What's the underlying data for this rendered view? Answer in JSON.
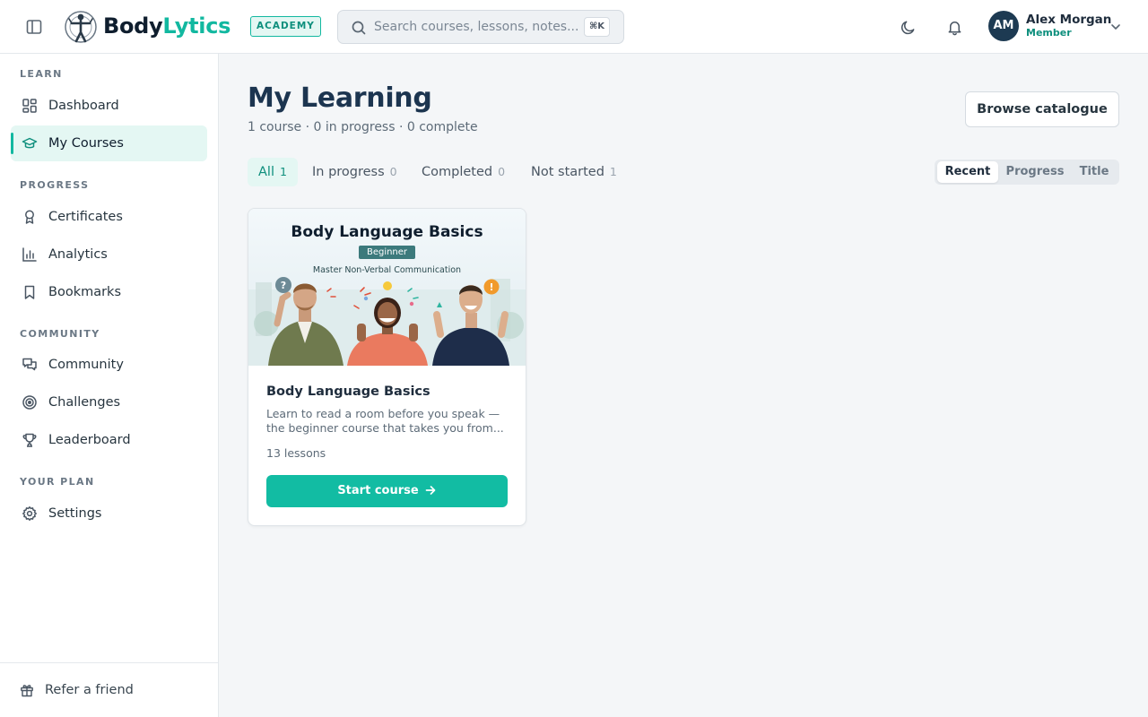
{
  "header": {
    "brand_part1": "Body",
    "brand_part2": "Lytics",
    "academy_badge": "ACADEMY",
    "search_placeholder": "Search courses, lessons, notes...",
    "search_shortcut": "⌘K",
    "user": {
      "initials": "AM",
      "name": "Alex Morgan",
      "role": "Member"
    }
  },
  "sidebar": {
    "sections": {
      "learn": "LEARN",
      "progress": "PROGRESS",
      "community": "COMMUNITY",
      "plan": "YOUR PLAN"
    },
    "items": {
      "dashboard": "Dashboard",
      "my_courses": "My Courses",
      "certificates": "Certificates",
      "analytics": "Analytics",
      "bookmarks": "Bookmarks",
      "community": "Community",
      "challenges": "Challenges",
      "leaderboard": "Leaderboard",
      "settings": "Settings"
    },
    "footer": "Refer a friend"
  },
  "main": {
    "title": "My Learning",
    "subtitle": "1 course · 0 in progress · 0 complete",
    "browse_button": "Browse catalogue",
    "filters": [
      {
        "label": "All",
        "count": "1"
      },
      {
        "label": "In progress",
        "count": "0"
      },
      {
        "label": "Completed",
        "count": "0"
      },
      {
        "label": "Not started",
        "count": "1"
      }
    ],
    "sort_options": [
      "Recent",
      "Progress",
      "Title"
    ],
    "course": {
      "thumb_title": "Body Language Basics",
      "thumb_level": "Beginner",
      "thumb_tagline": "Master Non-Verbal Communication",
      "title": "Body Language Basics",
      "description": "Learn to read a room before you speak — the beginner course that takes you from...",
      "meta": "13 lessons",
      "cta": "Start course"
    }
  },
  "colors": {
    "accent": "#12b8a0",
    "accent_soft": "#e4f7f3",
    "navy": "#1c3550",
    "avatar": "#1d3a52"
  },
  "icons": [
    "sidebar-toggle-icon",
    "search-icon",
    "moon-icon",
    "bell-icon",
    "chevron-down-icon",
    "grid-icon",
    "graduation-cap-icon",
    "award-icon",
    "bar-chart-icon",
    "bookmark-icon",
    "chat-icon",
    "target-icon",
    "trophy-icon",
    "gear-icon",
    "gift-icon",
    "arrow-right-icon"
  ]
}
